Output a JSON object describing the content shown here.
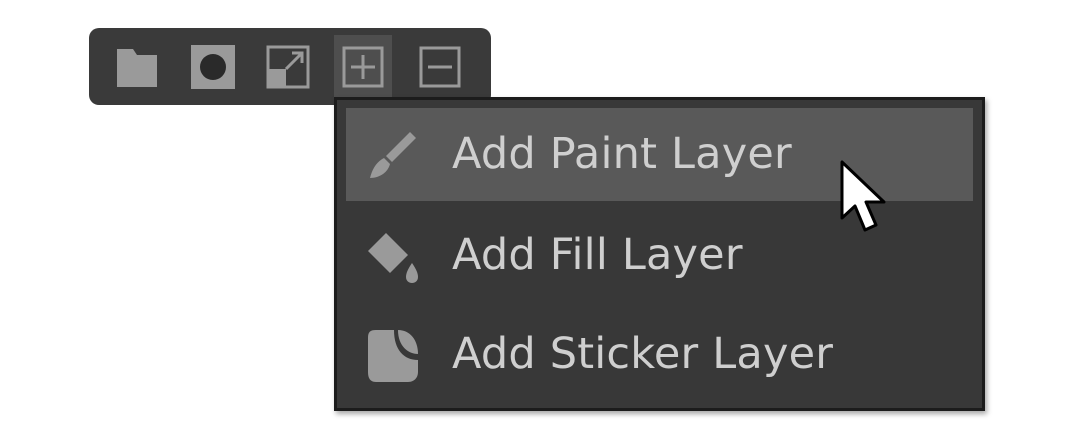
{
  "toolbar": {
    "buttons": [
      {
        "icon": "folder-icon",
        "active": false
      },
      {
        "icon": "circle-mask-icon",
        "active": false
      },
      {
        "icon": "expand-icon",
        "active": false
      },
      {
        "icon": "add-layer-icon",
        "active": true
      },
      {
        "icon": "remove-layer-icon",
        "active": false
      }
    ]
  },
  "menu": {
    "items": [
      {
        "label": "Add Paint Layer",
        "icon": "paintbrush-icon",
        "hovered": true
      },
      {
        "label": "Add Fill Layer",
        "icon": "paint-bucket-icon",
        "hovered": false
      },
      {
        "label": "Add Sticker Layer",
        "icon": "sticker-icon",
        "hovered": false
      }
    ]
  },
  "colors": {
    "toolbar_bg": "#3a3a3a",
    "menu_bg": "#383838",
    "hover_bg": "#595959",
    "icon_gray": "#9a9a9a",
    "text": "#cfcfcf"
  }
}
